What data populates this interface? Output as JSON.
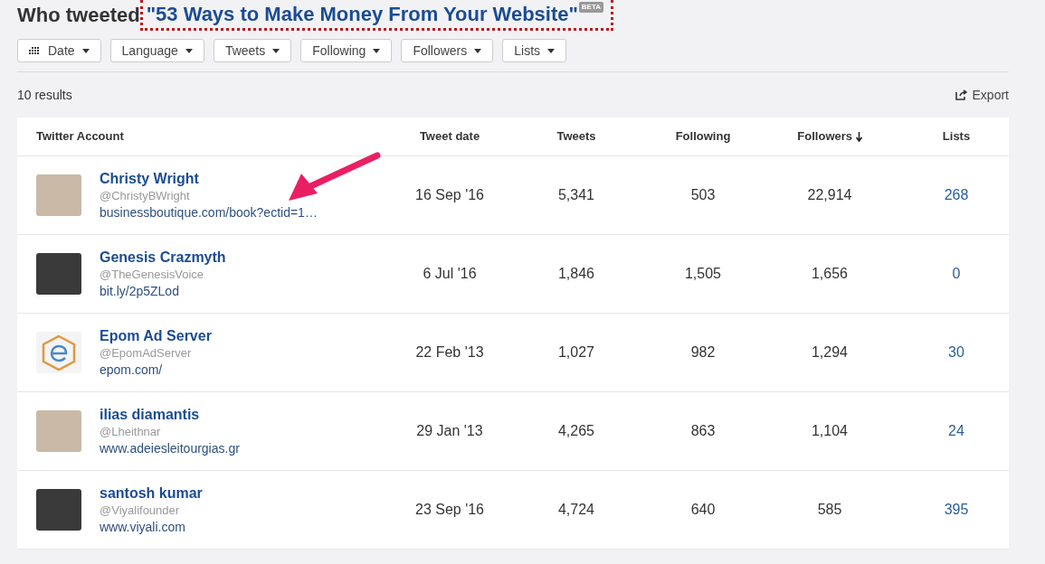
{
  "header": {
    "prefix": "Who tweeted",
    "title_link": "\"53 Ways to Make Money From Your Website\"",
    "badge": "BETA"
  },
  "filters": [
    {
      "label": "Date",
      "icon": true
    },
    {
      "label": "Language",
      "icon": false
    },
    {
      "label": "Tweets",
      "icon": false
    },
    {
      "label": "Following",
      "icon": false
    },
    {
      "label": "Followers",
      "icon": false
    },
    {
      "label": "Lists",
      "icon": false
    }
  ],
  "results_count": "10 results",
  "export_label": "Export",
  "table": {
    "columns": [
      {
        "label": "Twitter Account",
        "sorted": false
      },
      {
        "label": "Tweet date",
        "sorted": false
      },
      {
        "label": "Tweets",
        "sorted": false
      },
      {
        "label": "Following",
        "sorted": false
      },
      {
        "label": "Followers",
        "sorted": true
      },
      {
        "label": "Lists",
        "sorted": false
      }
    ],
    "rows": [
      {
        "avatar": {
          "kind": "photo"
        },
        "name": "Christy Wright",
        "handle": "@ChristyBWright",
        "url": "businessboutique.com/book?ectid=1…",
        "tweet_date": "16 Sep '16",
        "tweets": "5,341",
        "following": "503",
        "followers": "22,914",
        "lists": "268"
      },
      {
        "avatar": {
          "kind": "dark"
        },
        "name": "Genesis Crazmyth",
        "handle": "@TheGenesisVoice",
        "url": "bit.ly/2p5ZLod",
        "tweet_date": "6 Jul '16",
        "tweets": "1,846",
        "following": "1,505",
        "followers": "1,656",
        "lists": "0"
      },
      {
        "avatar": {
          "kind": "logo"
        },
        "name": "Epom Ad Server",
        "handle": "@EpomAdServer",
        "url": "epom.com/",
        "tweet_date": "22 Feb '13",
        "tweets": "1,027",
        "following": "982",
        "followers": "1,294",
        "lists": "30"
      },
      {
        "avatar": {
          "kind": "photo"
        },
        "name": "ilias diamantis",
        "handle": "@Lheithnar",
        "url": "www.adeiesleitourgias.gr",
        "tweet_date": "29 Jan '13",
        "tweets": "4,265",
        "following": "863",
        "followers": "1,104",
        "lists": "24"
      },
      {
        "avatar": {
          "kind": "dark"
        },
        "name": "santosh kumar",
        "handle": "@Viyalifounder",
        "url": "www.viyali.com",
        "tweet_date": "23 Sep '16",
        "tweets": "4,724",
        "following": "640",
        "followers": "585",
        "lists": "395"
      }
    ]
  }
}
